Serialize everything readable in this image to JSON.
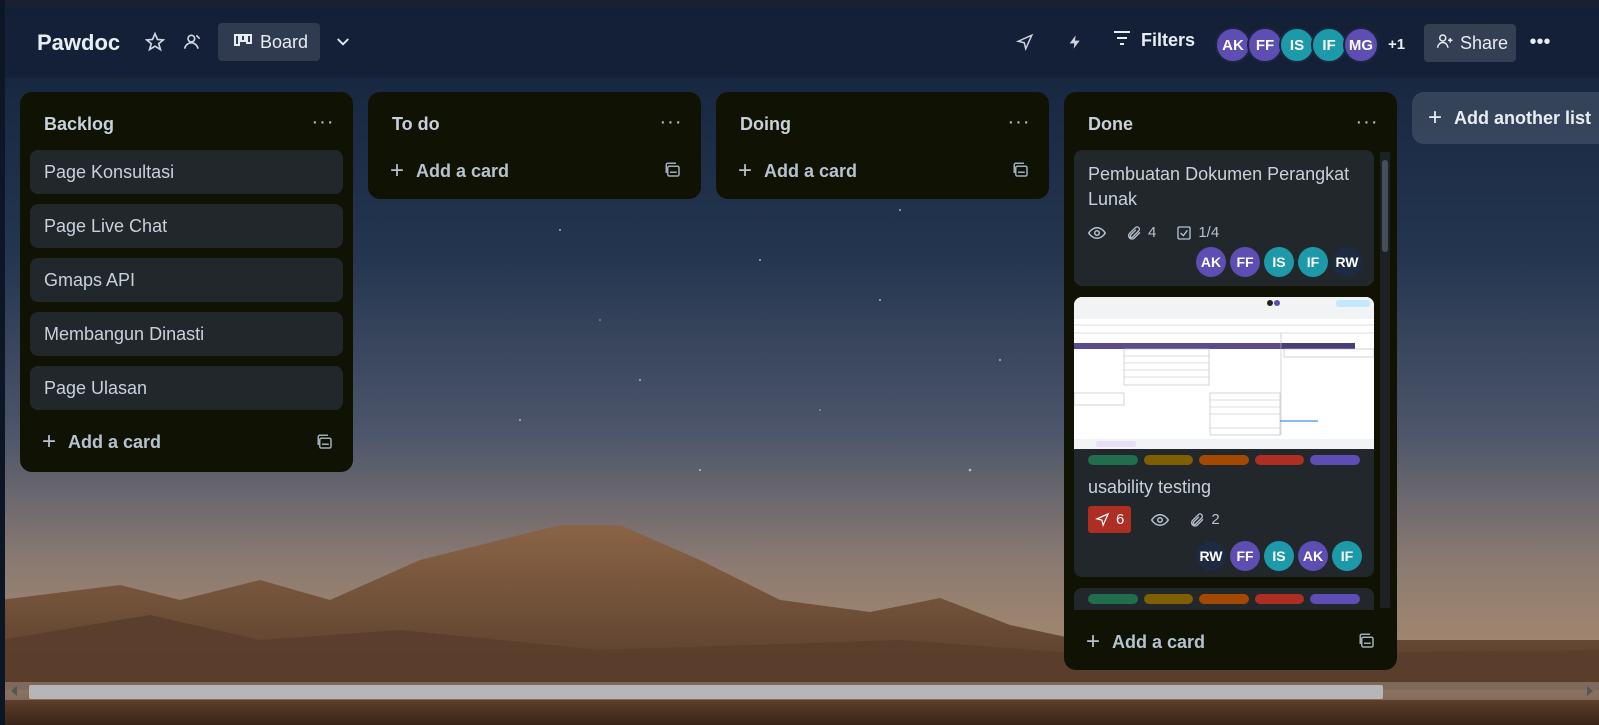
{
  "header": {
    "board_title": "Pawdoc",
    "view_label": "Board",
    "filters_label": "Filters",
    "share_label": "Share",
    "members": [
      {
        "initials": "AK",
        "color": "#5e4db2"
      },
      {
        "initials": "FF",
        "color": "#5e4db2"
      },
      {
        "initials": "IS",
        "color": "#1d9aaa"
      },
      {
        "initials": "IF",
        "color": "#1d9aaa"
      },
      {
        "initials": "MG",
        "color": "#5e4db2"
      }
    ],
    "extra_members": "+1"
  },
  "lists": [
    {
      "title": "Backlog",
      "cards": [
        "Page Konsultasi",
        "Page Live Chat",
        "Gmaps API",
        "Membangun Dinasti",
        "Page Ulasan"
      ],
      "add_card": "Add a card"
    },
    {
      "title": "To do",
      "add_card": "Add a card"
    },
    {
      "title": "Doing",
      "add_card": "Add a card"
    },
    {
      "title": "Done",
      "add_card": "Add a card",
      "card1": {
        "title": "Pembuatan Dokumen Perangkat Lunak",
        "attachments": "4",
        "checklist": "1/4",
        "members": [
          "AK",
          "FF",
          "IS",
          "IF",
          "RW"
        ]
      },
      "card2": {
        "title": "usability testing",
        "votes": "6",
        "attachments": "2",
        "members": [
          "RW",
          "FF",
          "IS",
          "AK",
          "IF"
        ],
        "label_colors": [
          "#216e4e",
          "#7f5f01",
          "#a54800",
          "#ae2e24",
          "#5e4db2"
        ]
      }
    }
  ],
  "add_list": "Add another list"
}
